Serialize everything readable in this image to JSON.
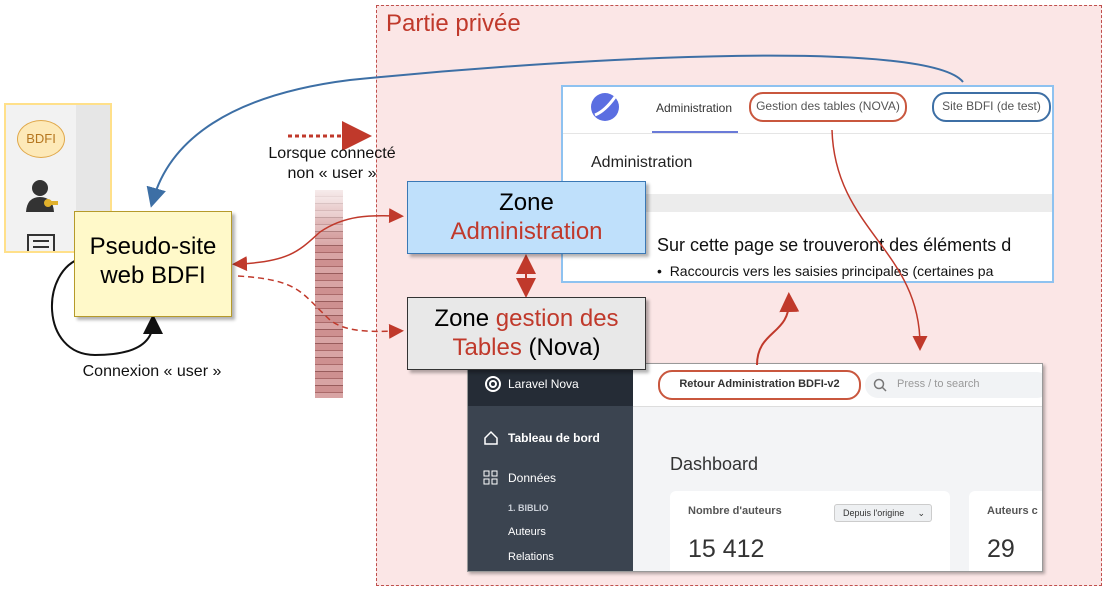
{
  "private_zone": {
    "title": "Partie privée"
  },
  "sidebar": {
    "badge": "BDFI"
  },
  "pseudo_site": {
    "line1": "Pseudo-site",
    "line2": "web BDFI"
  },
  "zone_admin": {
    "line1": "Zone",
    "line2": "Administration"
  },
  "zone_tables": {
    "part1": "Zone ",
    "part2": "gestion des",
    "part3": "Tables",
    "part4": " (Nova)"
  },
  "labels": {
    "when_connected_line1": "Lorsque connecté",
    "when_connected_line2": "non « user »",
    "login_user": "Connexion « user »"
  },
  "admin_screen": {
    "tab_admin": "Administration",
    "tab_tables": "Gestion des tables (NOVA)",
    "tab_site": "Site BDFI (de test)",
    "heading": "Administration",
    "body": "Sur cette page se trouveront des éléments d",
    "bullet": "Raccourcis vers les saisies principales (certaines pa"
  },
  "nova_screen": {
    "brand": "Laravel Nova",
    "back_button": "Retour Administration BDFI-v2",
    "search_placeholder": "Press / to search",
    "nav_dashboard": "Tableau de bord",
    "nav_data": "Données",
    "section": "1. BIBLIO",
    "nav_authors": "Auteurs",
    "nav_relations": "Relations",
    "page_title": "Dashboard",
    "card1_title": "Nombre d'auteurs",
    "card1_filter": "Depuis l'origine",
    "card1_value": "15 412",
    "card2_title": "Auteurs c",
    "card2_value": "29"
  },
  "colors": {
    "accent_red": "#c0392b",
    "accent_blue": "#3d6fa5"
  }
}
